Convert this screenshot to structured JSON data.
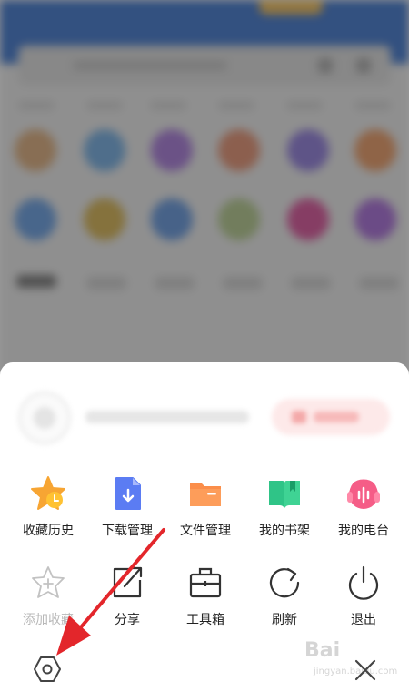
{
  "menu": {
    "row1": [
      {
        "label": "收藏历史",
        "icon": "star-clock-icon"
      },
      {
        "label": "下载管理",
        "icon": "download-file-icon"
      },
      {
        "label": "文件管理",
        "icon": "folder-icon"
      },
      {
        "label": "我的书架",
        "icon": "book-icon"
      },
      {
        "label": "我的电台",
        "icon": "headphones-icon"
      }
    ],
    "row2": [
      {
        "label": "添加收藏",
        "icon": "add-favorite-icon",
        "disabled": true
      },
      {
        "label": "分享",
        "icon": "share-icon"
      },
      {
        "label": "工具箱",
        "icon": "toolbox-icon"
      },
      {
        "label": "刷新",
        "icon": "refresh-icon"
      },
      {
        "label": "退出",
        "icon": "power-icon"
      }
    ]
  },
  "bottom": {
    "settings_icon": "settings-hexagon-icon",
    "close_icon": "close-icon"
  },
  "watermark": {
    "line1": "Bai",
    "line2": "jingyan.baidu.com"
  },
  "colors": {
    "star": "#f7a533",
    "download": "#5b7cf3",
    "folder": "#fb8e4a",
    "book": "#2fc487",
    "radio": "#f55d87",
    "arrow": "#e3262b"
  }
}
